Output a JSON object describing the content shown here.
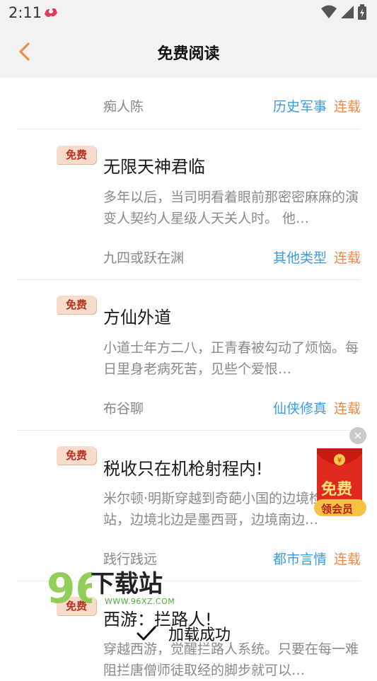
{
  "status_bar": {
    "time": "2:11"
  },
  "header": {
    "title": "免费阅读"
  },
  "first_row": {
    "author": "痴人陈",
    "category": "历史军事",
    "status": "连载"
  },
  "books": [
    {
      "badge": "免费",
      "title": "无限天神君临",
      "desc": "多年以后，当司明看着眼前那密密麻麻的演变人契约人星级人天关人时。 他…",
      "author": "九四或跃在渊",
      "category": "其他类型",
      "status": "连载"
    },
    {
      "badge": "免费",
      "title": "方仙外道",
      "desc": "小道士年方二八，正青春被勾动了烦恼。每日里身老病死苦，见些个爱恨…",
      "author": "布谷聊",
      "category": "仙侠修真",
      "status": "连载"
    },
    {
      "badge": "免费",
      "title": "税收只在机枪射程内!",
      "desc": "米尔顿·明斯穿越到奇葩小国的边境检查站，边境北边是墨西哥，边境南边…",
      "author": "践行践远",
      "category": "都市言情",
      "status": "连载"
    },
    {
      "badge": "免费",
      "title": "西游：拦路人!",
      "desc": "穿越西游，觉醒拦路人系统。只要在每一难阻拦唐僧师徒取经的脚步就可以…"
    }
  ],
  "float_ad": {
    "top_text": "免费",
    "bottom_text": "领会员",
    "close": "×"
  },
  "watermark": {
    "brand": "下载站",
    "url": "WWW.96XZ.COM"
  },
  "toast": {
    "text": "加载成功"
  },
  "colors": {
    "accent_orange": "#f08a44",
    "category_blue": "#3a9be8",
    "badge_bg": "#f7dccb"
  }
}
